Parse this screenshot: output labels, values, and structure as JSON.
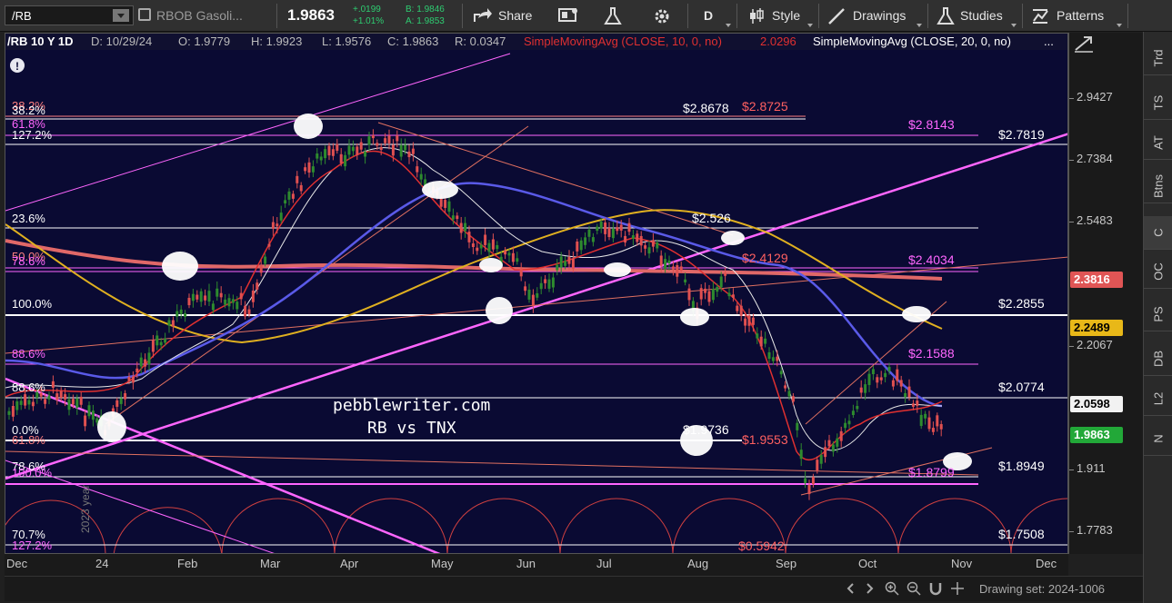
{
  "toolbar": {
    "symbol": "/RB",
    "instrument_name": "RBOB Gasoli...",
    "last_price": "1.9863",
    "net_change": "+.0199",
    "pct_change": "+1.01%",
    "bid": "B: 1.9846",
    "ask": "A: 1.9853",
    "share_label": "Share",
    "aggregation": "D",
    "style_label": "Style",
    "drawings_label": "Drawings",
    "studies_label": "Studies",
    "patterns_label": "Patterns"
  },
  "chart_header": {
    "title": "/RB 10 Y 1D",
    "date": "D: 10/29/24",
    "open": "O: 1.9779",
    "high": "H: 1.9923",
    "low": "L: 1.9576",
    "close": "C: 1.9863",
    "range": "R: 0.0347",
    "sma10_label": "SimpleMovingAvg (CLOSE, 10, 0, no)",
    "sma10_value": "2.0296",
    "sma20_label": "SimpleMovingAvg (CLOSE, 20, 0, no)",
    "more": "..."
  },
  "colors": {
    "background": "#0a0a33",
    "sma10": "#e03030",
    "sma20": "#e8e8e8",
    "sma50": "#5a5ae8",
    "sma100": "#e0b020",
    "sma200": "#e06868",
    "fib_magenta": "#ff66ff",
    "fib_white": "#ffffff",
    "up_candle": "#2e8b2e",
    "down_candle": "#e05050",
    "cycle_arcs": "#d04040"
  },
  "price_axis": {
    "ticks": [
      "2.9427",
      "2.7384",
      "2.5483",
      "2.3816",
      "2.2489",
      "2.2067",
      "2.0598",
      "1.9863",
      "1.911",
      "1.7783"
    ],
    "badges": {
      "sma200": "2.3816",
      "sma100": "2.2489",
      "sma20": "2.0598",
      "last": "1.9863"
    }
  },
  "time_axis": {
    "labels": [
      "Dec",
      "24",
      "Feb",
      "Mar",
      "Apr",
      "May",
      "Jun",
      "Jul",
      "Aug",
      "Sep",
      "Oct",
      "Nov",
      "Dec"
    ]
  },
  "annotations": {
    "watermark_line1": "pebblewriter.com",
    "watermark_line2": "RB vs TNX",
    "fib_left": [
      "38.2%",
      "38.2%",
      "61.8%",
      "127.2%",
      "23.6%",
      "50.0%",
      "78.6%",
      "100.0%",
      "88.6%",
      "88.6%",
      "0.0%",
      "61.8%",
      "78.6%",
      "100.0%",
      "70.7%",
      "127.2%"
    ],
    "price_labels": {
      "p2_8678": "$2.8678",
      "p2_8725": "$2.8725",
      "p2_8143": "$2.8143",
      "p2_7819": "$2.7819",
      "p2_526": "$2.526",
      "p2_4129": "$2.4129",
      "p2_4034": "$2.4034",
      "p2_2855": "$2.2855",
      "p2_1588": "$2.1588",
      "p2_0774": "$2.0774",
      "p1_9736": "$1.9736",
      "p1_9553": "$1.9553",
      "p1_8949": "$1.8949",
      "p1_8799": "$1.8799",
      "p1_7508": "$1.7508",
      "p0_5942": "$0.5942"
    },
    "cycle_label": "2023 year"
  },
  "status_bar": {
    "drawing_set": "Drawing set: 2024-1006"
  },
  "right_sidebar": {
    "tabs": [
      "Trd",
      "TS",
      "AT",
      "Btns",
      "C",
      "OC",
      "PS",
      "DB",
      "L2",
      "N"
    ],
    "active": "C"
  }
}
